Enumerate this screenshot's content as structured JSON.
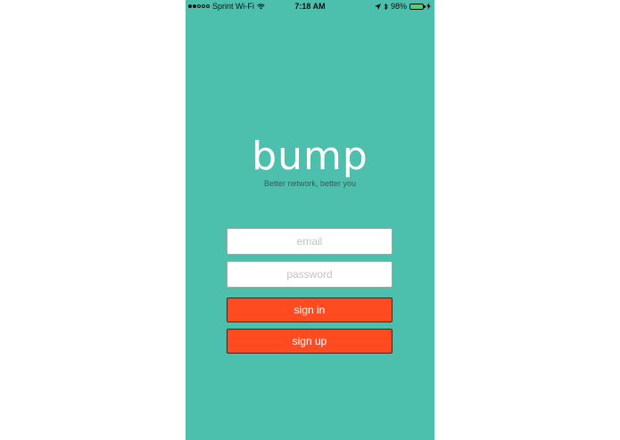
{
  "status_bar": {
    "carrier": "Sprint Wi-Fi",
    "signal_filled": 2,
    "signal_total": 5,
    "time": "7:18 AM",
    "battery_percent": "98%",
    "battery_level": 0.98,
    "icons": [
      "wifi-icon",
      "location-arrow-icon",
      "bluetooth-icon",
      "battery-icon",
      "charging-bolt-icon"
    ]
  },
  "brand": {
    "logo": "bump",
    "tagline": "Better network, better you"
  },
  "form": {
    "email_placeholder": "email",
    "password_placeholder": "password",
    "sign_in_label": "sign in",
    "sign_up_label": "sign up"
  },
  "colors": {
    "background": "#4dbfad",
    "button": "#ff4b1f",
    "battery": "#4cd964"
  }
}
